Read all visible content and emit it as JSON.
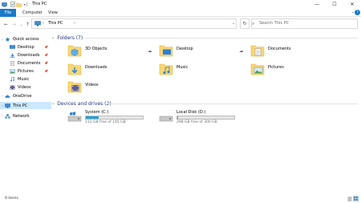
{
  "window": {
    "title": "This PC",
    "minimize_glyph": "—",
    "maximize_glyph": "☐",
    "close_glyph": "✕"
  },
  "ribbon": {
    "file_label": "File",
    "tabs": [
      "Computer",
      "View"
    ]
  },
  "address": {
    "path": "This PC",
    "search_placeholder": "Search This PC"
  },
  "sidebar": {
    "quick_access": "Quick access",
    "items": [
      "Desktop",
      "Downloads",
      "Documents",
      "Pictures",
      "Music",
      "Videos"
    ],
    "onedrive": "OneDrive",
    "this_pc": "This PC",
    "network": "Network"
  },
  "folders": {
    "header": "Folders (7)",
    "items": [
      "3D Objects",
      "Desktop",
      "Documents",
      "Downloads",
      "Music",
      "Pictures",
      "Videos"
    ]
  },
  "drives": {
    "header": "Devices and drives (2)",
    "items": [
      {
        "name": "System (C:)",
        "free": "112 GB free of 145 GB",
        "used_fraction": 0.228
      },
      {
        "name": "Local Disk (D:)",
        "free": "298 GB free of 300 GB",
        "used_fraction": 0.007
      }
    ]
  },
  "status": {
    "count": "9 items"
  },
  "colors": {
    "accent": "#1979ca",
    "selection": "#cce8ff",
    "header_text": "#1e3287",
    "drive_fill": "#26a0da",
    "folder_yellow": "#f8d775"
  }
}
